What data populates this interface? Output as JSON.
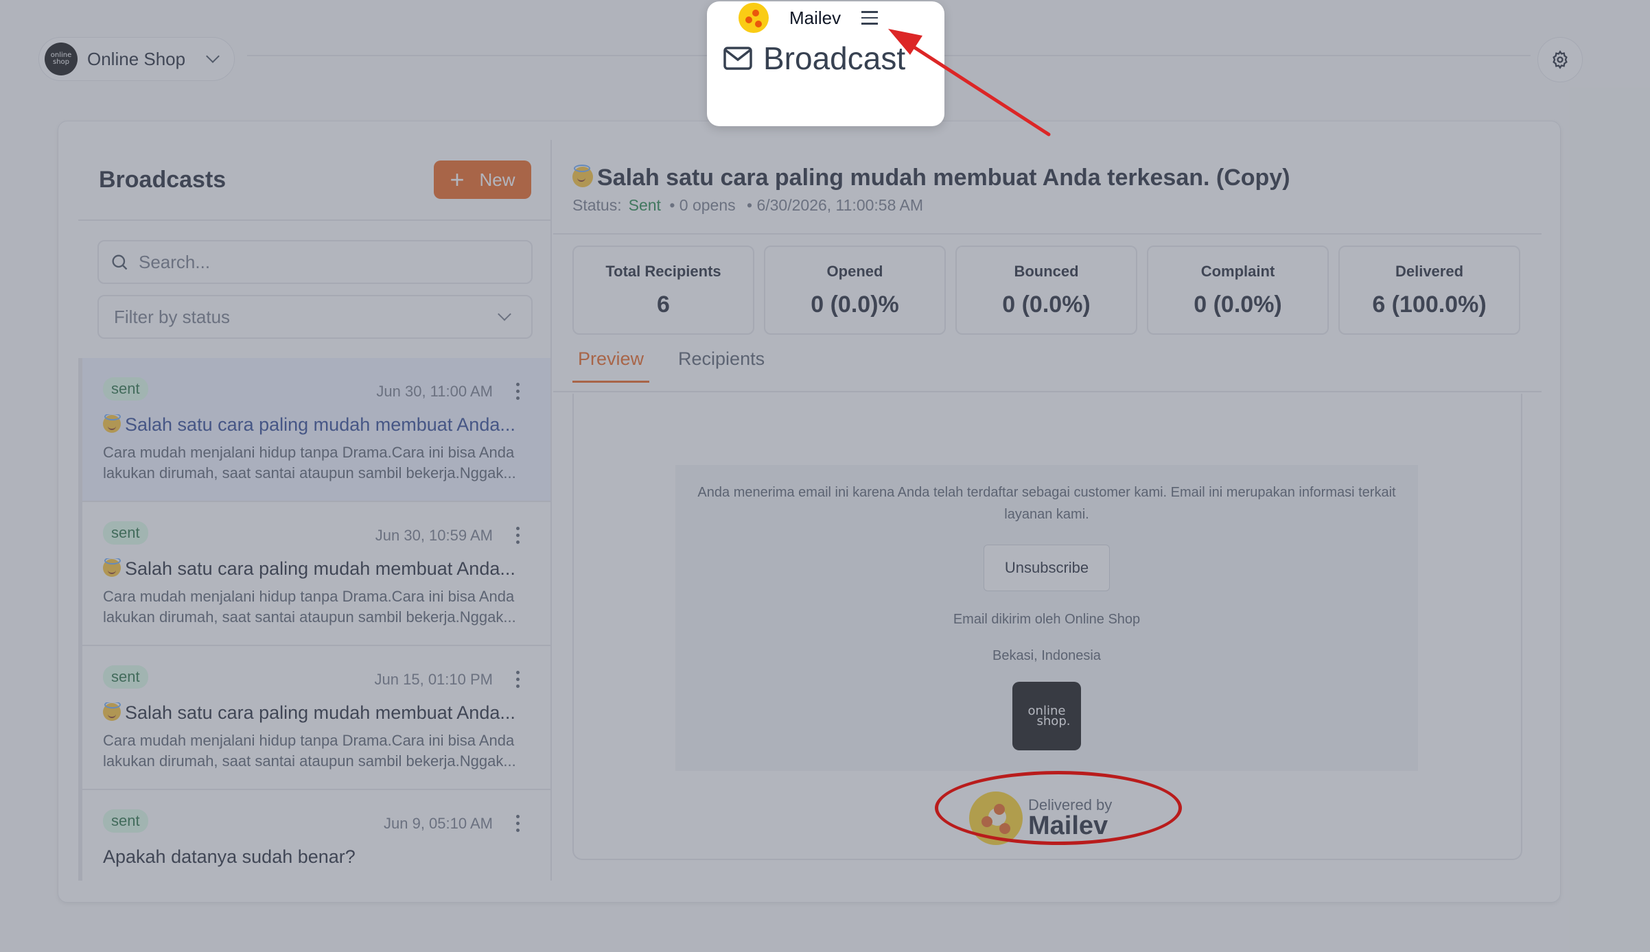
{
  "workspace": {
    "logo_text": "online shop",
    "name": "Online Shop"
  },
  "left": {
    "title": "Broadcasts",
    "new_label": "New",
    "search_placeholder": "Search...",
    "filter_placeholder": "Filter by status",
    "items": [
      {
        "badge": "sent",
        "date": "Jun 30, 11:00 AM",
        "title": "Salah satu cara paling mudah membuat Anda...",
        "desc": "Cara mudah menjalani hidup tanpa Drama.Cara ini bisa Anda lakukan dirumah, saat santai ataupun sambil bekerja.Nggak..."
      },
      {
        "badge": "sent",
        "date": "Jun 30, 10:59 AM",
        "title": "Salah satu cara paling mudah membuat Anda...",
        "desc": "Cara mudah menjalani hidup tanpa Drama.Cara ini bisa Anda lakukan dirumah, saat santai ataupun sambil bekerja.Nggak..."
      },
      {
        "badge": "sent",
        "date": "Jun 15, 01:10 PM",
        "title": "Salah satu cara paling mudah membuat Anda...",
        "desc": "Cara mudah menjalani hidup tanpa Drama.Cara ini bisa Anda lakukan dirumah, saat santai ataupun sambil bekerja.Nggak..."
      },
      {
        "badge": "sent",
        "date": "Jun 9, 05:10 AM",
        "title": "Apakah datanya sudah benar?",
        "desc": ""
      }
    ]
  },
  "detail": {
    "title": "Salah satu cara paling mudah membuat Anda terkesan. (Copy)",
    "status_label": "Status:",
    "status_value": "Sent",
    "opens": "• 0 opens",
    "datetime": "• 6/30/2026, 11:00:58 AM",
    "stats": [
      {
        "label": "Total Recipients",
        "value": "6"
      },
      {
        "label": "Opened",
        "value": "0 (0.0)%"
      },
      {
        "label": "Bounced",
        "value": "0 (0.0%)"
      },
      {
        "label": "Complaint",
        "value": "0 (0.0%)"
      },
      {
        "label": "Delivered",
        "value": "6 (100.0%)"
      }
    ],
    "tabs": [
      "Preview",
      "Recipients"
    ]
  },
  "email": {
    "footer_note": "Anda menerima email ini karena Anda telah terdaftar sebagai customer kami. Email ini merupakan informasi terkait layanan kami.",
    "unsubscribe": "Unsubscribe",
    "sent_by": "Email dikirim oleh Online Shop",
    "address": "Bekasi, Indonesia",
    "logo_line1": "online",
    "logo_line2": "shop.",
    "delivered_small": "Delivered by",
    "delivered_big": "Mailev"
  },
  "popup": {
    "app_name": "Mailev",
    "title": "Broadcast"
  },
  "colors": {
    "accent": "#ea580c",
    "sent": "#15803d",
    "annotation": "#dc2626"
  }
}
